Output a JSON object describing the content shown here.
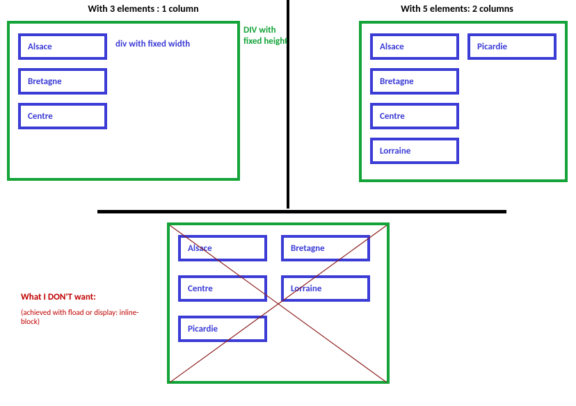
{
  "colors": {
    "green": "#13a338",
    "blue": "#3b3bd6",
    "red": "#c00000"
  },
  "panel1": {
    "heading": "With 3 elements : 1 column",
    "items": [
      "Alsace",
      "Bretagne",
      "Centre"
    ],
    "label_div_width": "div with fixed width",
    "label_div_height": "DIV with fixed height"
  },
  "panel2": {
    "heading": "With 5 elements: 2 columns",
    "col1": [
      "Alsace",
      "Bretagne",
      "Centre",
      "Lorraine"
    ],
    "col2": [
      "Picardie"
    ]
  },
  "panel3": {
    "note_title": "What I DON'T want:",
    "note_sub": "(achieved with fload or display: inline-block)",
    "col1": [
      "Alsace",
      "Centre",
      "Picardie"
    ],
    "col2": [
      "Bretagne",
      "Lorraine"
    ]
  }
}
